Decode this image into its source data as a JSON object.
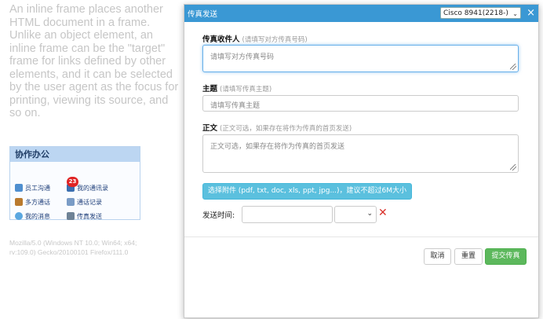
{
  "background": {
    "paragraph": "An inline frame places another HTML document in a frame. Unlike an object element, an inline frame can be the \"target\" frame for links defined by other elements, and it can be selected by the user agent as the focus for printing, viewing its source, and so on.",
    "office_panel": {
      "title": "协作办公",
      "items": [
        {
          "label": "员工沟通",
          "icon": "people-icon"
        },
        {
          "label": "我的通讯录",
          "icon": "address-book-icon"
        },
        {
          "label": "多方通话",
          "icon": "group-call-icon"
        },
        {
          "label": "通话记录",
          "icon": "call-log-icon"
        },
        {
          "label": "我的消息",
          "icon": "message-icon"
        },
        {
          "label": "传真发送",
          "icon": "fax-icon"
        }
      ],
      "badge": "23"
    },
    "user_agent": "Mozilla/5.0 (Windows NT 10.0; Win64; x64; rv:109.0) Gecko/20100101 Firefox/111.0"
  },
  "modal": {
    "title": "传真发送",
    "device": "Cisco 8941(2218-)",
    "close": "×",
    "recipient": {
      "label": "传真收件人",
      "hint": "(请填写对方传真号码)",
      "placeholder": "请填写对方传真号码"
    },
    "subject": {
      "label": "主题",
      "hint": "(请填写传真主题)",
      "placeholder": "请填写传真主题"
    },
    "body": {
      "label": "正文",
      "hint": "(正文可选，如果存在将作为传真的首页发送)",
      "placeholder": "正文可选，如果存在将作为传真的首页发送"
    },
    "attach_button": "选择附件 (pdf, txt, doc, xls, ppt, jpg...)，建议不超过6M大小",
    "send_time_label": "发送时间:",
    "clear": "✕",
    "buttons": {
      "cancel": "取消",
      "reset": "重置",
      "submit": "提交传真"
    }
  },
  "colors": {
    "header": "#3a98d4",
    "attach": "#5bc0de",
    "submit": "#5cb85c",
    "clear": "#d9322b"
  }
}
